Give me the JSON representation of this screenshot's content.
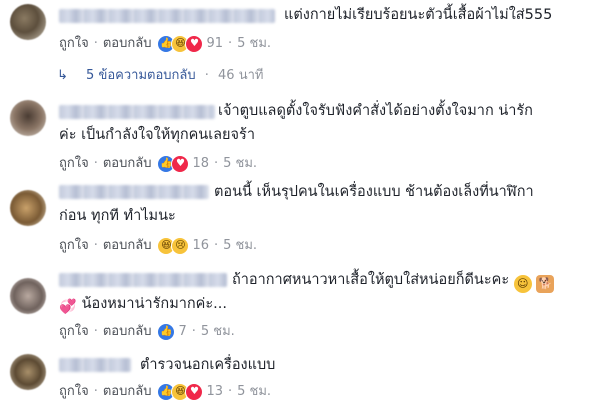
{
  "comments": [
    {
      "text_lines": [
        "แต่งกายไม่เรียบร้อยนะตัวนี้เสื้อผ้าไม่ใส่555"
      ],
      "like_label": "ถูกใจ",
      "reply_label": "ตอบกลับ",
      "reactions": [
        "like-icon",
        "haha-icon",
        "love-icon"
      ],
      "reaction_count": "91",
      "time": "5 ชม."
    },
    {
      "text_lines": [
        "เจ้าตูบแลดูตั้งใจรับฟังคำสั่งได้อย่างตั้งใจมาก น่ารัก",
        "ค่ะ เป็นกำลังใจให้ทุกคนเลยจร้า"
      ],
      "like_label": "ถูกใจ",
      "reply_label": "ตอบกลับ",
      "reactions": [
        "like-icon",
        "love-icon"
      ],
      "reaction_count": "18",
      "time": "5 ชม."
    },
    {
      "text_lines": [
        "ตอนนี้ เห็นรุปคนในเครื่องแบบ ช้านต้องเล็งที่นาฬิกา",
        "ก่อน ทุกที ทำไมนะ"
      ],
      "like_label": "ถูกใจ",
      "reply_label": "ตอบกลับ",
      "reactions": [
        "haha-icon",
        "sad-icon"
      ],
      "reaction_count": "16",
      "time": "5 ชม."
    },
    {
      "text_lines": [
        "ถ้าอากาศหนาวหาเสื้อให้ตูบใส่หน่อยก็ดีนะคะ",
        "น้องหมาน่ารักมากค่ะ..."
      ],
      "like_label": "ถูกใจ",
      "reply_label": "ตอบกลับ",
      "reactions": [
        "like-icon"
      ],
      "reaction_count": "7",
      "time": "5 ชม."
    },
    {
      "text_lines": [
        "ตำรวจนอกเครื่องแบบ"
      ],
      "like_label": "ถูกใจ",
      "reply_label": "ตอบกลับ",
      "reactions": [
        "like-icon",
        "haha-icon",
        "love-icon"
      ],
      "reaction_count": "13",
      "time": "5 ชม."
    }
  ],
  "reply_thread": {
    "label": "5 ข้อความตอบกลับ",
    "time": "46 นาที"
  },
  "colors": {
    "link": "#365899",
    "meta": "#90949c",
    "like": "#3578e5",
    "love": "#f0284a",
    "haha": "#f7c33b"
  }
}
